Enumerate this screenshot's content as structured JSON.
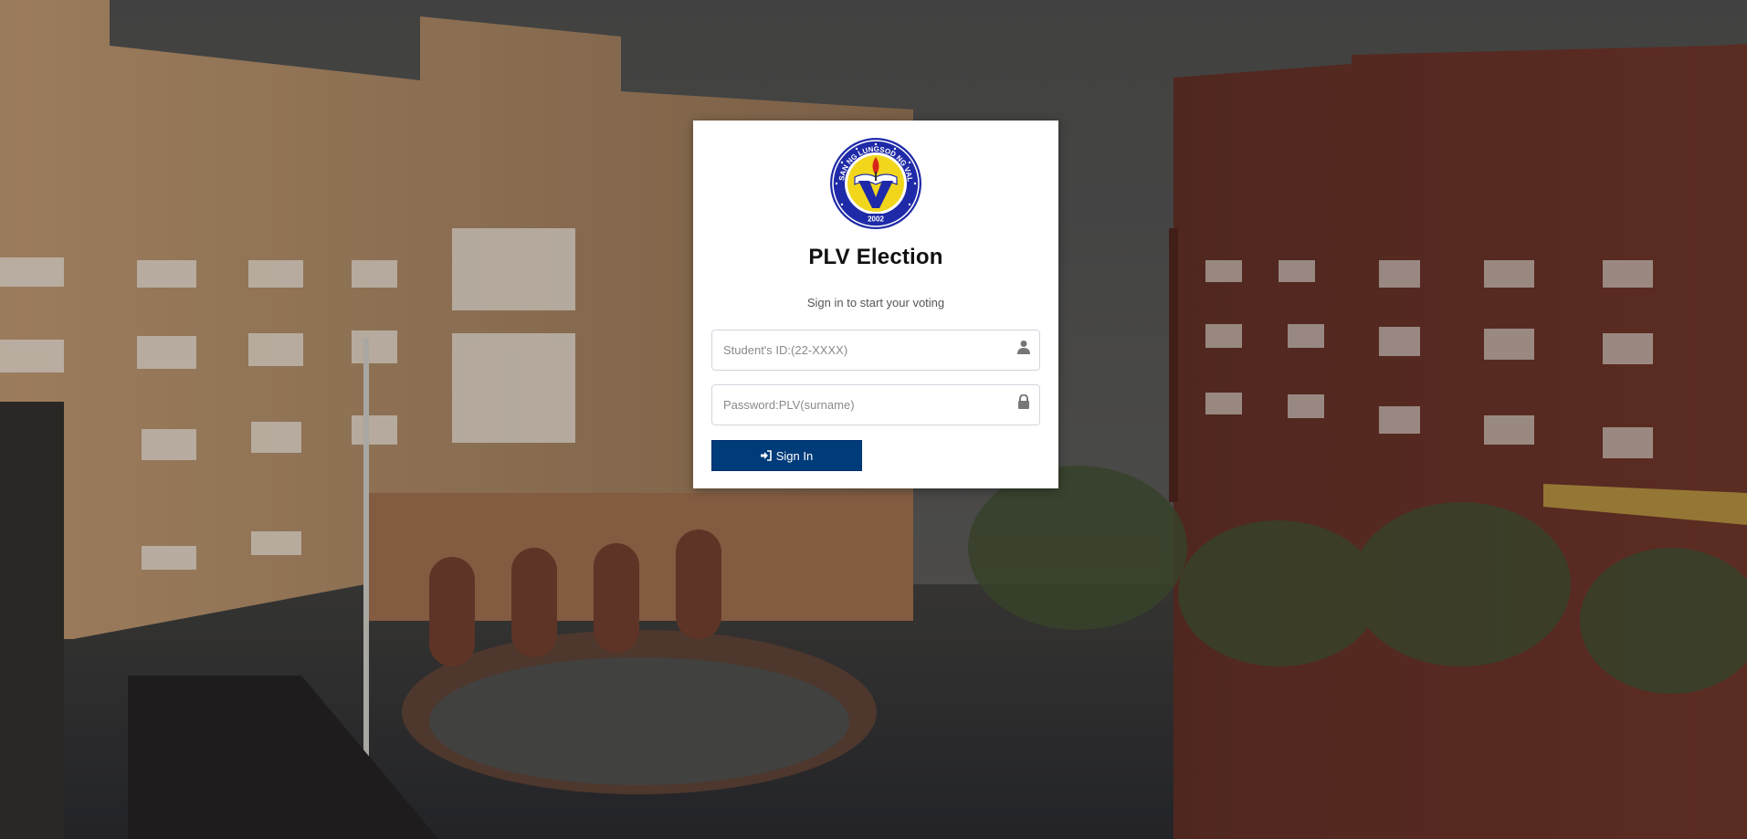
{
  "app": {
    "title": "PLV Election",
    "subtitle": "Sign in to start your voting",
    "logo": {
      "icon": "university-seal-icon",
      "ring_text": "PAMANTASAN NG LUNGSOD NG VALENZUELA",
      "year": "2002",
      "colors": {
        "ring": "#1f2aa8",
        "inner": "#f1d61c",
        "letter": "#1f2aa8",
        "flame": "#d6241c"
      }
    }
  },
  "form": {
    "student_id": {
      "placeholder": "Student's ID:(22-XXXX)",
      "value": "",
      "icon": "user-icon"
    },
    "password": {
      "placeholder": "Password:PLV(surname)",
      "value": "",
      "icon": "lock-icon"
    },
    "signin": {
      "label": "Sign In",
      "icon": "sign-in-icon",
      "color": "#003b7a"
    }
  },
  "background": {
    "description_icon": "campus-buildings-image"
  }
}
